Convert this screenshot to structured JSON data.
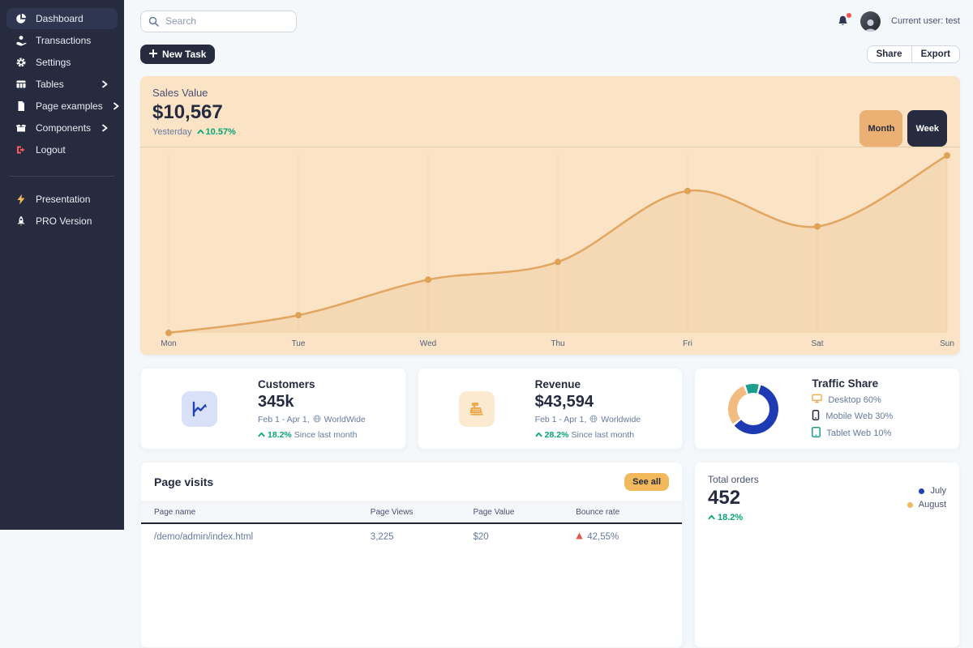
{
  "sidebar": {
    "items": [
      {
        "label": "Dashboard",
        "icon": "pie-chart-icon",
        "active": true,
        "chevron": false
      },
      {
        "label": "Transactions",
        "icon": "hand-coin-icon",
        "active": false,
        "chevron": false
      },
      {
        "label": "Settings",
        "icon": "gear-icon",
        "active": false,
        "chevron": false
      },
      {
        "label": "Tables",
        "icon": "table-icon",
        "active": false,
        "chevron": true
      },
      {
        "label": "Page examples",
        "icon": "document-icon",
        "active": false,
        "chevron": true
      },
      {
        "label": "Components",
        "icon": "box-icon",
        "active": false,
        "chevron": true
      },
      {
        "label": "Logout",
        "icon": "logout-icon",
        "active": false,
        "chevron": false
      }
    ],
    "secondary_items": [
      {
        "label": "Presentation",
        "icon": "bolt-icon"
      },
      {
        "label": "PRO Version",
        "icon": "rocket-icon"
      }
    ]
  },
  "topbar": {
    "search_placeholder": "Search",
    "user_label": "Current user: test"
  },
  "toolbar": {
    "new_task_label": "New Task",
    "share_label": "Share",
    "export_label": "Export"
  },
  "sales_card": {
    "title": "Sales Value",
    "value": "$10,567",
    "period_label": "Yesterday",
    "change": "10.57%",
    "month_label": "Month",
    "week_label": "Week"
  },
  "chart_data": [
    {
      "type": "line",
      "title": "Sales Value (week)",
      "categories": [
        "Mon",
        "Tue",
        "Wed",
        "Thu",
        "Fri",
        "Sat",
        "Sun"
      ],
      "values": [
        0,
        1,
        3,
        4,
        8,
        6,
        10
      ],
      "ylim": [
        0,
        10
      ],
      "grid": "vertical-dashed",
      "line_color": "#E2A661",
      "point_color": "#DFA156",
      "fill_color": "rgba(216,150,70,0.14)",
      "grid_color": "#D9A468",
      "legend_position": "none"
    },
    {
      "type": "pie",
      "title": "Traffic Share",
      "labels": [
        "Desktop",
        "Mobile Web",
        "Tablet Web"
      ],
      "values": [
        60,
        30,
        10
      ],
      "colors": [
        "#1F3BB3",
        "#F2BC80",
        "#1B9E8C"
      ]
    }
  ],
  "stats_cards": [
    {
      "title": "Customers",
      "value": "345k",
      "period": "Feb 1 - Apr 1,",
      "scope": "WorldWide",
      "change": "18.2%",
      "change_suffix": "Since last month"
    },
    {
      "title": "Revenue",
      "value": "$43,594",
      "period": "Feb 1 - Apr 1,",
      "scope": "Worldwide",
      "change": "28.2%",
      "change_suffix": "Since last month"
    }
  ],
  "traffic_card": {
    "title": "Traffic Share",
    "legend": [
      {
        "label": "Desktop",
        "value": "60%",
        "icon": "desktop-icon"
      },
      {
        "label": "Mobile Web",
        "value": "30%",
        "icon": "mobile-icon"
      },
      {
        "label": "Tablet Web",
        "value": "10%",
        "icon": "tablet-icon"
      }
    ]
  },
  "page_visits": {
    "title": "Page visits",
    "see_all_label": "See all",
    "columns": [
      "Page name",
      "Page Views",
      "Page Value",
      "Bounce rate"
    ],
    "rows": [
      {
        "name": "/demo/admin/index.html",
        "views": "3,225",
        "value": "$20",
        "bounce": "42,55%",
        "trend": "up-red"
      }
    ]
  },
  "total_orders": {
    "title": "Total orders",
    "value": "452",
    "change": "18.2%",
    "legend": [
      {
        "label": "July",
        "color": "#1F41BB"
      },
      {
        "label": "August",
        "color": "#F2B85C"
      }
    ]
  },
  "colors": {
    "sidebar_bg": "#262B40",
    "page_bg": "#F5F8FB",
    "accent_green": "#05A677",
    "accent_red": "#FA5252",
    "accent_orange": "#F2B85C",
    "sales_card_bg": "#FBE3C6",
    "primary_navy": "#262B40"
  }
}
